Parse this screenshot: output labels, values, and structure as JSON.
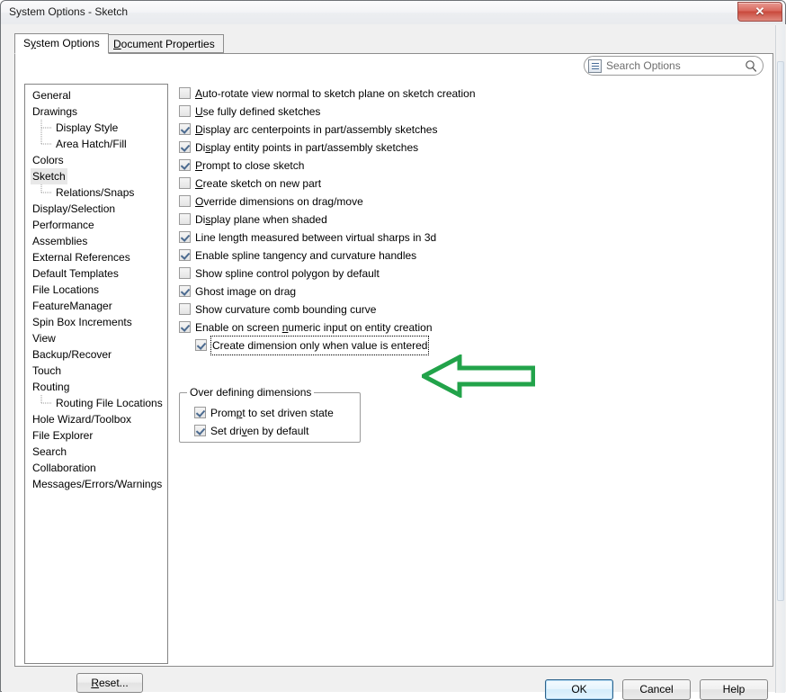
{
  "window": {
    "title": "System Options - Sketch",
    "close_label": "✕",
    "close_icon": "close-icon"
  },
  "tabs": [
    {
      "label_pre": "S",
      "label_accel": "y",
      "label_post": "stem Options",
      "full": "System Options",
      "active": true
    },
    {
      "label_pre": "",
      "label_accel": "D",
      "label_post": "ocument Properties",
      "full": "Document Properties",
      "active": false
    }
  ],
  "search": {
    "placeholder": "Search Options",
    "list_icon": "options-list-icon",
    "magnifier_icon": "search-icon"
  },
  "tree": {
    "items": [
      {
        "label": "General",
        "level": 0,
        "selected": false
      },
      {
        "label": "Drawings",
        "level": 0,
        "selected": false
      },
      {
        "label": "Display Style",
        "level": 1,
        "selected": false
      },
      {
        "label": "Area Hatch/Fill",
        "level": 1,
        "selected": false
      },
      {
        "label": "Colors",
        "level": 0,
        "selected": false
      },
      {
        "label": "Sketch",
        "level": 0,
        "selected": true
      },
      {
        "label": "Relations/Snaps",
        "level": 1,
        "selected": false
      },
      {
        "label": "Display/Selection",
        "level": 0,
        "selected": false
      },
      {
        "label": "Performance",
        "level": 0,
        "selected": false
      },
      {
        "label": "Assemblies",
        "level": 0,
        "selected": false
      },
      {
        "label": "External References",
        "level": 0,
        "selected": false
      },
      {
        "label": "Default Templates",
        "level": 0,
        "selected": false
      },
      {
        "label": "File Locations",
        "level": 0,
        "selected": false
      },
      {
        "label": "FeatureManager",
        "level": 0,
        "selected": false
      },
      {
        "label": "Spin Box Increments",
        "level": 0,
        "selected": false
      },
      {
        "label": "View",
        "level": 0,
        "selected": false
      },
      {
        "label": "Backup/Recover",
        "level": 0,
        "selected": false
      },
      {
        "label": "Touch",
        "level": 0,
        "selected": false
      },
      {
        "label": "Routing",
        "level": 0,
        "selected": false
      },
      {
        "label": "Routing File Locations",
        "level": 1,
        "selected": false
      },
      {
        "label": "Hole Wizard/Toolbox",
        "level": 0,
        "selected": false
      },
      {
        "label": "File Explorer",
        "level": 0,
        "selected": false
      },
      {
        "label": "Search",
        "level": 0,
        "selected": false
      },
      {
        "label": "Collaboration",
        "level": 0,
        "selected": false
      },
      {
        "label": "Messages/Errors/Warnings",
        "level": 0,
        "selected": false
      }
    ]
  },
  "reset_button": {
    "pre": "",
    "accel": "R",
    "post": "eset...",
    "full": "Reset..."
  },
  "options": [
    {
      "pre": "",
      "accel": "A",
      "post": "uto-rotate view normal to sketch plane on sketch creation",
      "full": "Auto-rotate view normal to sketch plane on sketch creation",
      "checked": false,
      "indent": false,
      "focused": false
    },
    {
      "pre": "",
      "accel": "U",
      "post": "se fully defined sketches",
      "full": "Use fully defined sketches",
      "checked": false,
      "indent": false,
      "focused": false
    },
    {
      "pre": "",
      "accel": "D",
      "post": "isplay arc centerpoints in part/assembly sketches",
      "full": "Display arc centerpoints in part/assembly sketches",
      "checked": true,
      "indent": false,
      "focused": false
    },
    {
      "pre": "Di",
      "accel": "s",
      "post": "play entity points in part/assembly sketches",
      "full": "Display entity points in part/assembly sketches",
      "checked": true,
      "indent": false,
      "focused": false
    },
    {
      "pre": "",
      "accel": "P",
      "post": "rompt to close sketch",
      "full": "Prompt to close sketch",
      "checked": true,
      "indent": false,
      "focused": false
    },
    {
      "pre": "",
      "accel": "C",
      "post": "reate sketch on new part",
      "full": "Create sketch on new part",
      "checked": false,
      "indent": false,
      "focused": false
    },
    {
      "pre": "",
      "accel": "O",
      "post": "verride dimensions on drag/move",
      "full": "Override dimensions on drag/move",
      "checked": false,
      "indent": false,
      "focused": false
    },
    {
      "pre": "Di",
      "accel": "s",
      "post": "play plane when shaded",
      "full": "Display plane when shaded",
      "checked": false,
      "indent": false,
      "focused": false
    },
    {
      "pre": "",
      "accel": "",
      "post": "Line length measured between virtual sharps in 3d",
      "full": "Line length measured between virtual sharps in 3d",
      "checked": true,
      "indent": false,
      "focused": false
    },
    {
      "pre": "",
      "accel": "",
      "post": "Enable spline tangency and curvature handles",
      "full": "Enable spline tangency and curvature handles",
      "checked": true,
      "indent": false,
      "focused": false
    },
    {
      "pre": "",
      "accel": "",
      "post": "Show spline control polygon by default",
      "full": "Show spline control polygon by default",
      "checked": false,
      "indent": false,
      "focused": false
    },
    {
      "pre": "",
      "accel": "",
      "post": "Ghost image on drag",
      "full": "Ghost image on drag",
      "checked": true,
      "indent": false,
      "focused": false
    },
    {
      "pre": "",
      "accel": "",
      "post": "Show curvature comb bounding curve",
      "full": "Show curvature comb bounding curve",
      "checked": false,
      "indent": false,
      "focused": false
    },
    {
      "pre": "Enable on screen ",
      "accel": "n",
      "post": "umeric input on entity creation",
      "full": "Enable on screen numeric input on entity creation",
      "checked": true,
      "indent": false,
      "focused": false
    },
    {
      "pre": "",
      "accel": "",
      "post": "Create dimension only when value is entered",
      "full": "Create dimension only when value is entered",
      "checked": true,
      "indent": true,
      "focused": true
    }
  ],
  "group": {
    "legend": "Over defining dimensions",
    "rows": [
      {
        "pre": "Prom",
        "accel": "p",
        "post": "t to set driven state",
        "full": "Prompt to set driven state",
        "checked": true
      },
      {
        "pre": "Set dri",
        "accel": "v",
        "post": "en by default",
        "full": "Set driven by default",
        "checked": true
      }
    ]
  },
  "annotation": {
    "arrow_icon": "green-left-arrow-annotation",
    "color": "#22a34a"
  },
  "footer": {
    "ok": "OK",
    "cancel": "Cancel",
    "help": "Help"
  }
}
